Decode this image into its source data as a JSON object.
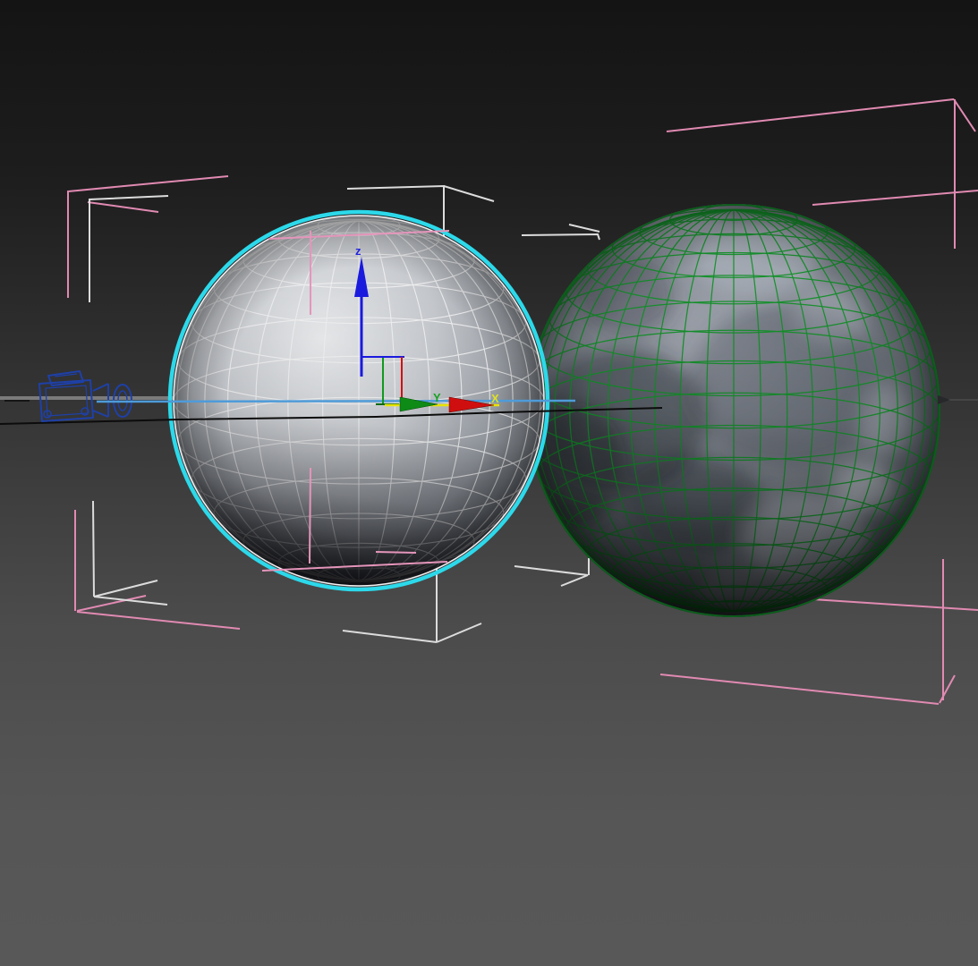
{
  "viewport": {
    "type": "3d-perspective-viewport",
    "background_top": "#141414",
    "background_bottom": "#585858",
    "gizmo": {
      "z_label": "z",
      "y_label": "Y",
      "x_label": "X",
      "z_color": "#2222e0",
      "y_color": "#17a322",
      "x_color": "#e0e024",
      "active_axis_color": "#e8e400",
      "x_axis_color": "#d31111",
      "y_axis_color": "#0f9a1c"
    },
    "objects": {
      "camera": {
        "name": "camera",
        "color": "#1e40a8"
      },
      "selected_sphere": {
        "name": "selected-wireframe-sphere",
        "wire_color": "#f4f4f6",
        "selection_color": "#2cd9ea"
      },
      "textured_sphere": {
        "name": "textured-moon-sphere",
        "wire_color": "#13962a"
      },
      "pink_helper_boxes": {
        "color": "#e18ab2"
      },
      "white_helper_boxes": {
        "color": "#dcdcdc"
      }
    },
    "lines": {
      "ground_gray": "#7b7b7b",
      "target_blue": "#4e9bd9",
      "horizon_black": "#0c0c0c",
      "right_gray": "#454545"
    }
  }
}
